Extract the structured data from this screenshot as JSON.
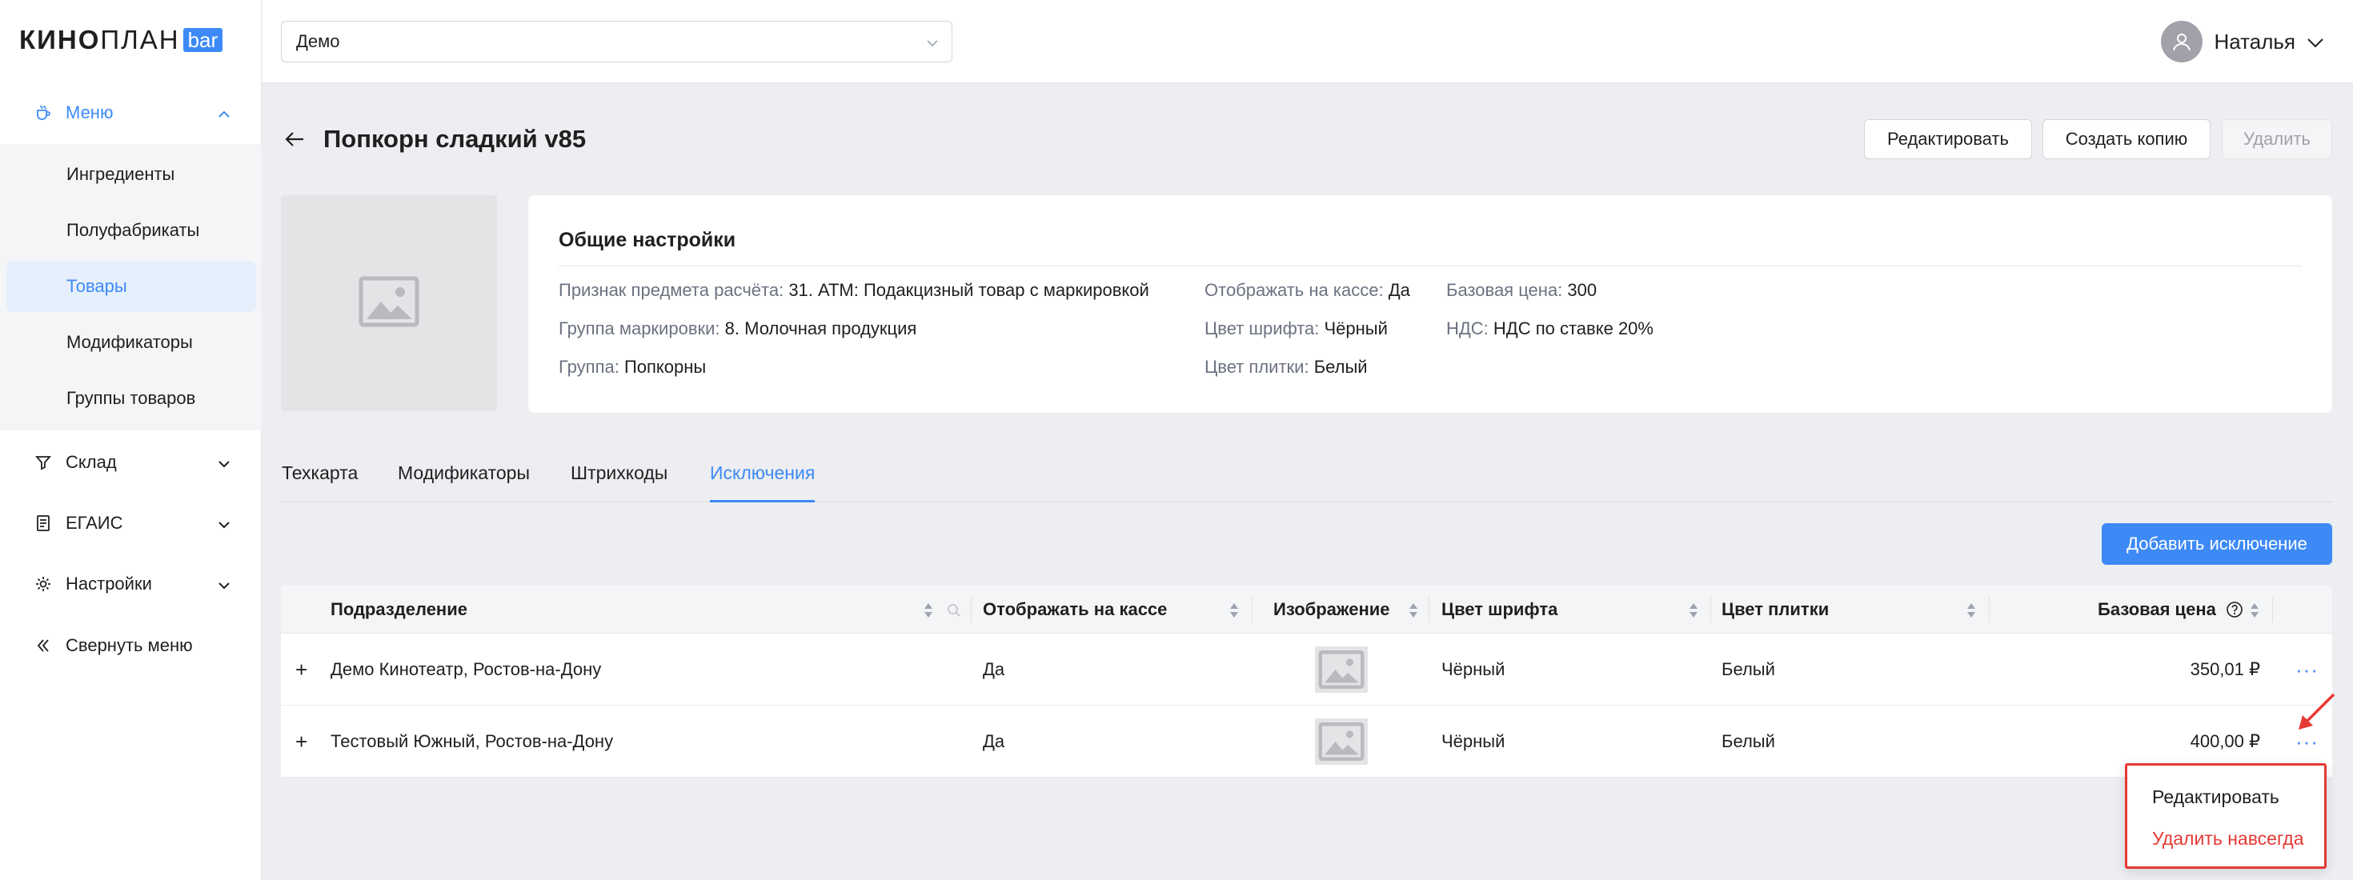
{
  "logo": {
    "bold": "КИНО",
    "light": "ПЛАН",
    "badge": "bar"
  },
  "sidebar": {
    "menu": {
      "label": "Меню",
      "icon": "cup-icon"
    },
    "submenu": [
      "Ингредиенты",
      "Полуфабрикаты",
      "Товары",
      "Модификаторы",
      "Группы товаров"
    ],
    "active_submenu": "Товары",
    "items": [
      {
        "label": "Склад",
        "icon": "funnel-icon"
      },
      {
        "label": "ЕГАИС",
        "icon": "document-icon"
      },
      {
        "label": "Настройки",
        "icon": "gear-icon"
      },
      {
        "label": "Свернуть меню",
        "icon": "double-chevron-left-icon"
      }
    ]
  },
  "topbar": {
    "cinema_select": "Демо",
    "user_name": "Наталья"
  },
  "page": {
    "title": "Попкорн сладкий v85",
    "buttons": {
      "edit": "Редактировать",
      "copy": "Создать копию",
      "delete": "Удалить"
    }
  },
  "settings": {
    "title": "Общие настройки",
    "fields": {
      "calc_sign": {
        "k": "Признак предмета расчёта:",
        "v": "31. АТМ: Подакцизный товар с маркировкой"
      },
      "marking_group": {
        "k": "Группа маркировки:",
        "v": "8. Молочная продукция"
      },
      "group": {
        "k": "Группа:",
        "v": "Попкорны"
      },
      "show_on_cashier": {
        "k": "Отображать на кассе:",
        "v": "Да"
      },
      "font_color": {
        "k": "Цвет шрифта:",
        "v": "Чёрный"
      },
      "tile_color": {
        "k": "Цвет плитки:",
        "v": "Белый"
      },
      "base_price": {
        "k": "Базовая цена:",
        "v": "300"
      },
      "vat": {
        "k": "НДС:",
        "v": "НДС по ставке 20%"
      }
    }
  },
  "tabs": [
    "Техкарта",
    "Модификаторы",
    "Штрихкоды",
    "Исключения"
  ],
  "active_tab": "Исключения",
  "add_exception_label": "Добавить исключение",
  "table": {
    "columns": [
      "Подразделение",
      "Отображать на кассе",
      "Изображение",
      "Цвет шрифта",
      "Цвет плитки",
      "Базовая цена"
    ],
    "rows": [
      {
        "expand": "+",
        "unit": "Демо Кинотеатр, Ростов-на-Дону",
        "show": "Да",
        "font": "Чёрный",
        "tile": "Белый",
        "price": "350,01 ₽",
        "actions": "···"
      },
      {
        "expand": "+",
        "unit": "Тестовый Южный, Ростов-на-Дону",
        "show": "Да",
        "font": "Чёрный",
        "tile": "Белый",
        "price": "400,00 ₽",
        "actions": "···"
      }
    ]
  },
  "dropdown": {
    "edit": "Редактировать",
    "delete": "Удалить навсегда"
  },
  "colors": {
    "accent": "#3d8af7",
    "danger": "#e53935"
  }
}
